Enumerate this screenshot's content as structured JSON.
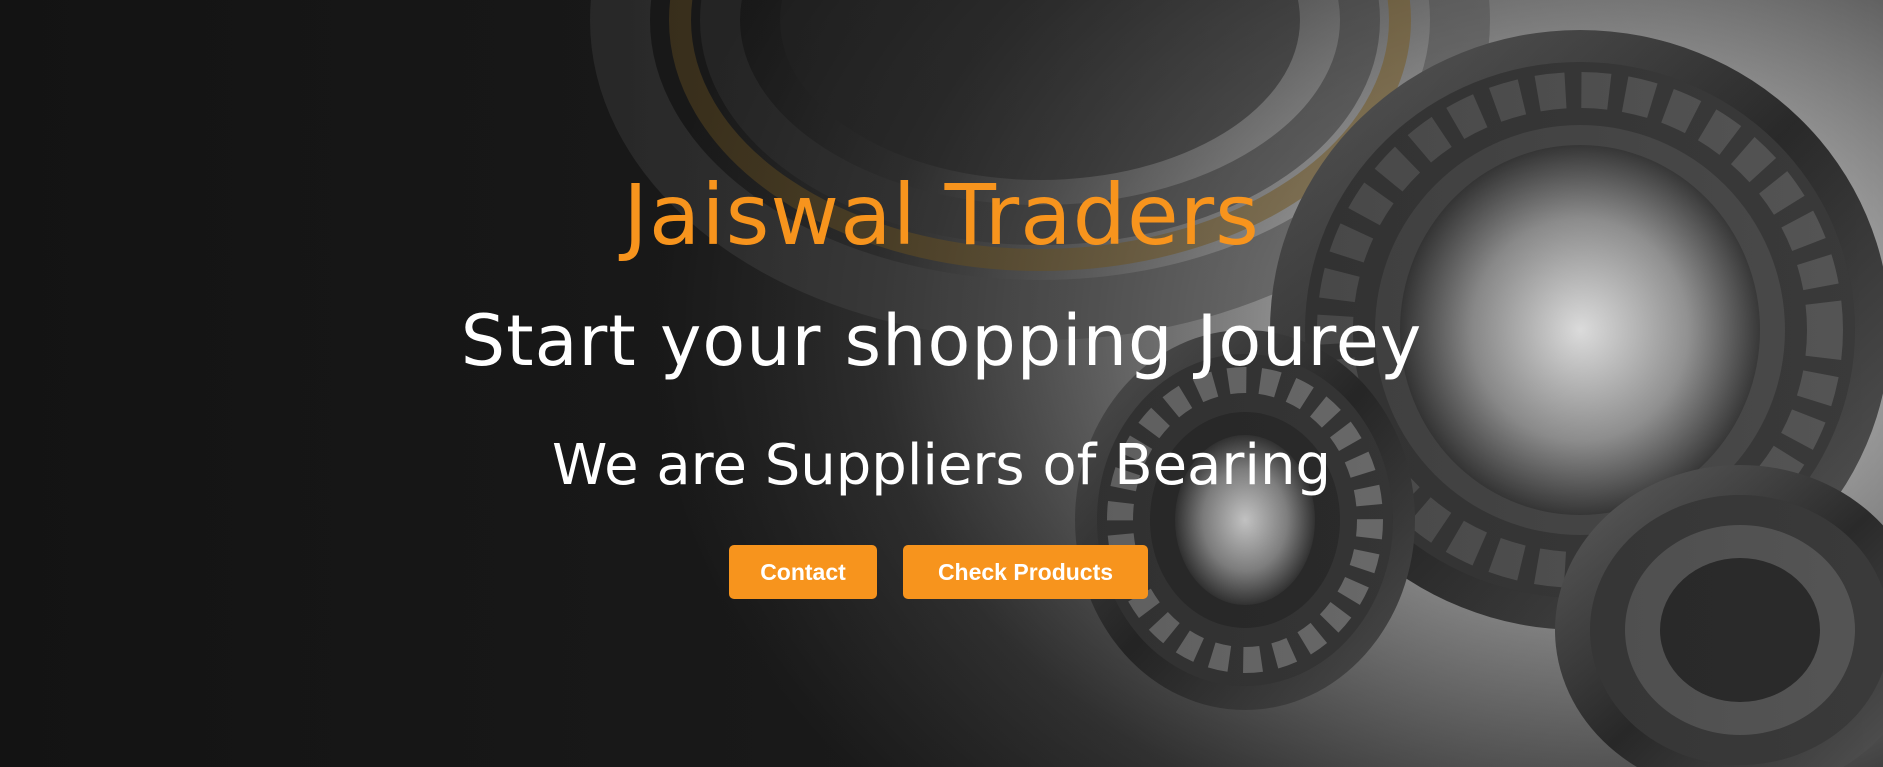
{
  "hero": {
    "brand": "Jaiswal Traders",
    "tagline": "Start your shopping Jourey",
    "subline": "We are Suppliers of Bearing",
    "background_image": "industrial ball and roller bearings photo"
  },
  "actions": {
    "contact_label": "Contact",
    "products_label": "Check Products"
  },
  "colors": {
    "accent": "#F7941D",
    "text_light": "#FFFFFF",
    "button_text": "#FFFFFF"
  }
}
